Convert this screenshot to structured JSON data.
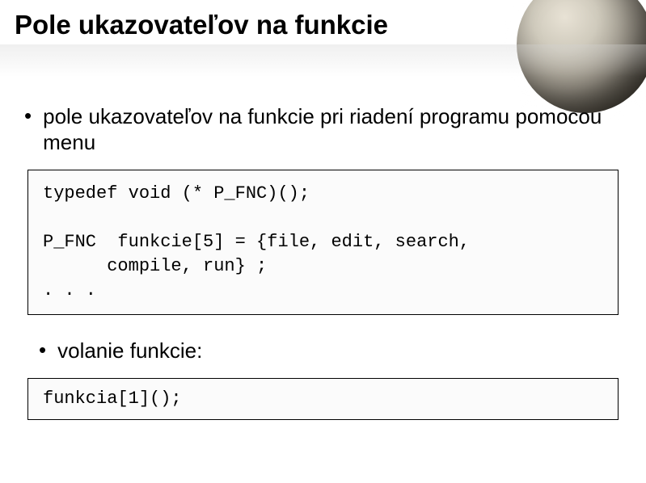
{
  "title": "Pole ukazovateľov na funkcie",
  "bullet1": "pole ukazovateľov na funkcie pri riadení programu pomocou menu",
  "code1": {
    "line1": "typedef void (* P_FNC)();",
    "line2": "P_FNC  funkcie[5] = {file, edit, search,",
    "line3": "      compile, run} ;",
    "line4": ". . ."
  },
  "bullet2": "volanie funkcie:",
  "code2": {
    "line1": "funkcia[1]();"
  }
}
